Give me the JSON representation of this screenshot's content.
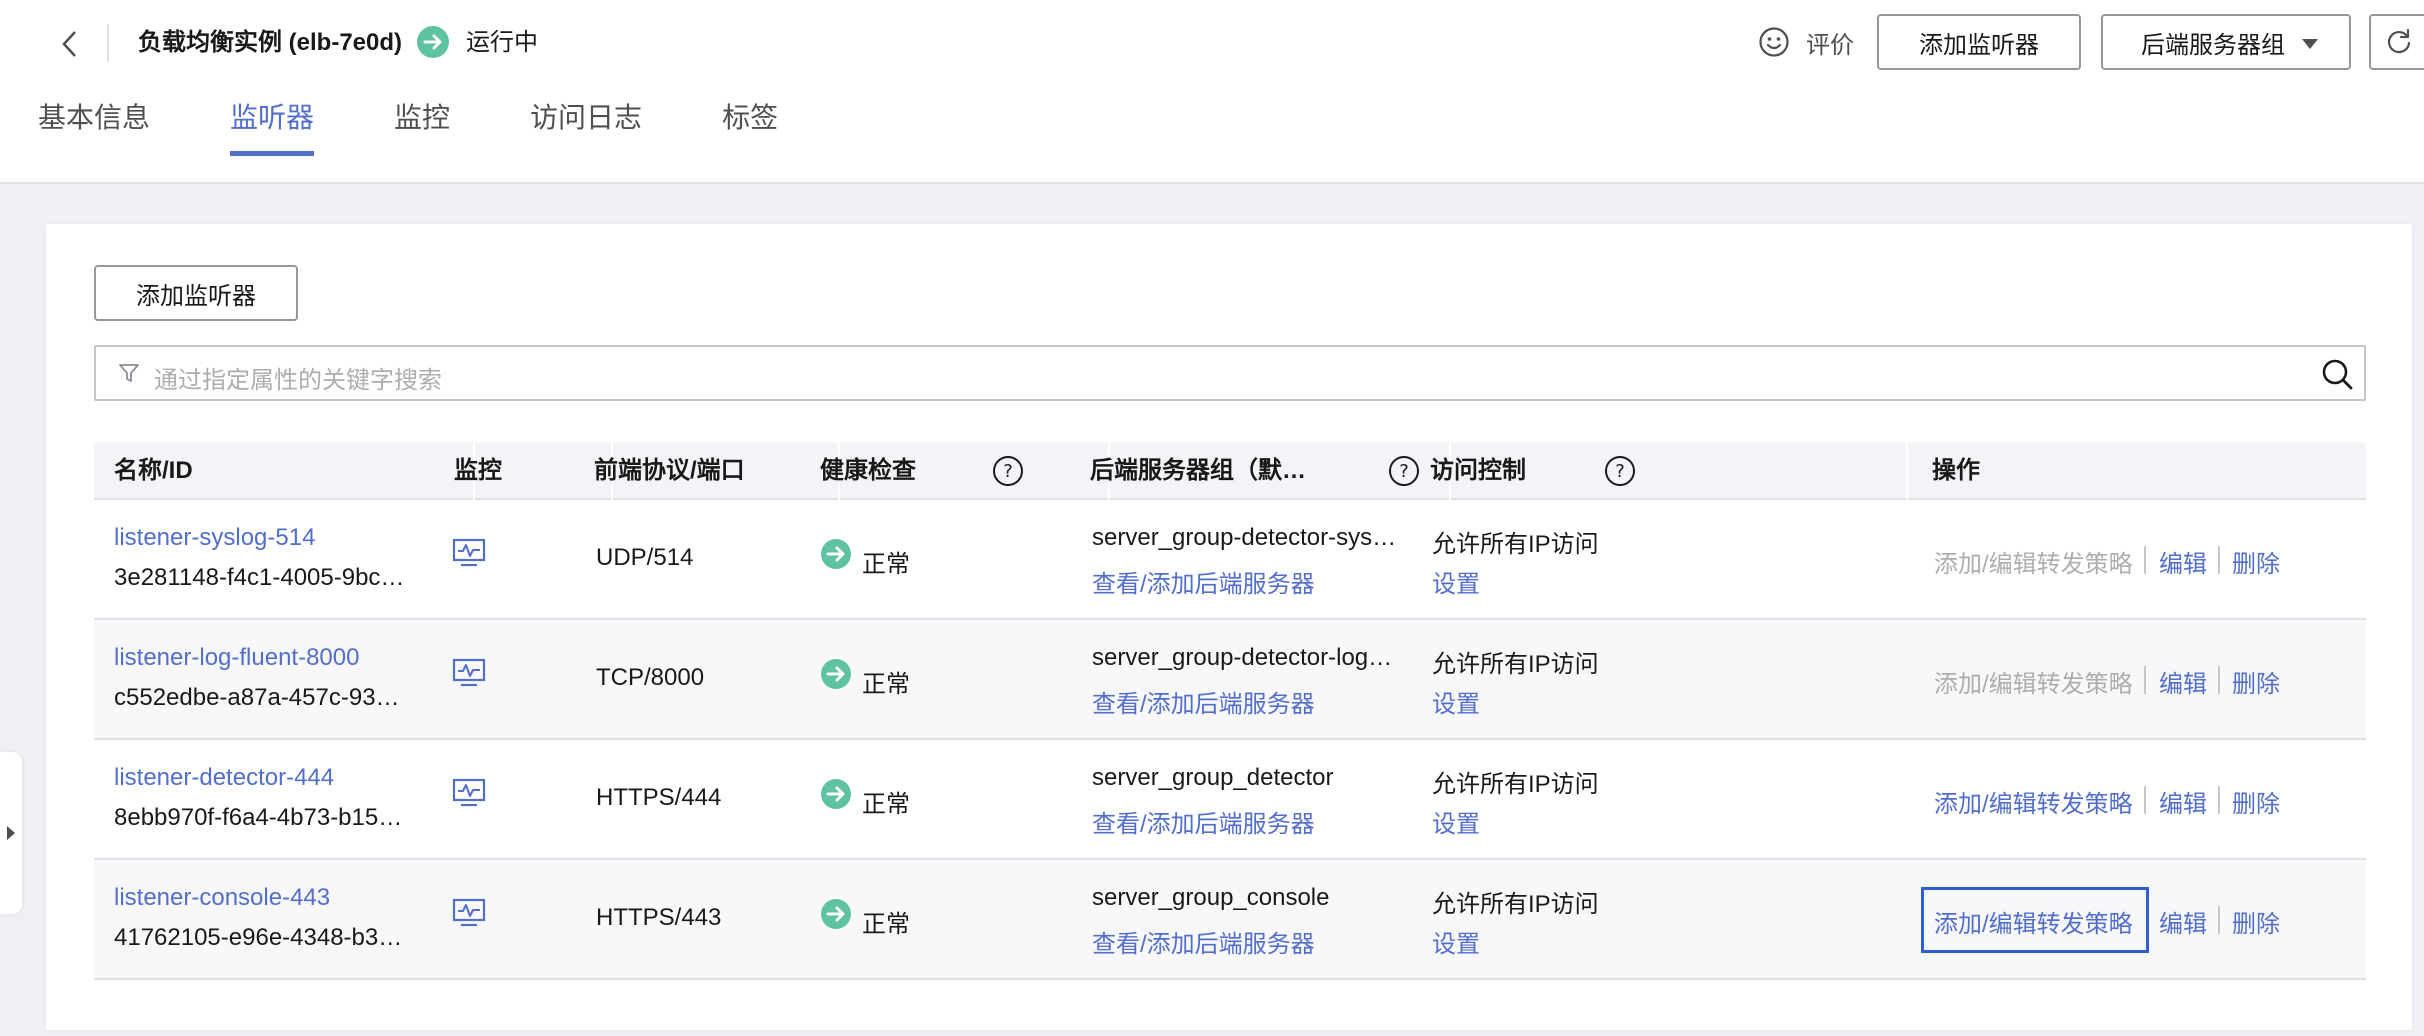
{
  "header": {
    "title": "负载均衡实例 (elb-7e0d)",
    "status": "运行中",
    "feedback_label": "评价",
    "add_listener_button": "添加监听器",
    "server_group_button": "后端服务器组",
    "status_color": "#5ec29e",
    "accent_color": "#526ecc"
  },
  "tabs": [
    {
      "label": "基本信息",
      "active": false
    },
    {
      "label": "监听器",
      "active": true
    },
    {
      "label": "监控",
      "active": false
    },
    {
      "label": "访问日志",
      "active": false
    },
    {
      "label": "标签",
      "active": false
    }
  ],
  "toolbar": {
    "add_listener_button": "添加监听器",
    "search_placeholder": "通过指定属性的关键字搜索"
  },
  "table": {
    "columns": [
      "名称/ID",
      "监控",
      "前端协议/端口",
      "健康检查",
      "后端服务器组（默…",
      "访问控制",
      "操作"
    ],
    "rows": [
      {
        "name": "listener-syslog-514",
        "id": "3e281148-f4c1-4005-9bc…",
        "protocol": "UDP/514",
        "health": "正常",
        "server_group": "server_group-detector-sys…",
        "server_group_link": "查看/添加后端服务器",
        "access": "允许所有IP访问",
        "access_link": "设置",
        "op_policy": "添加/编辑转发策略",
        "op_policy_enabled": false,
        "op_edit": "编辑",
        "op_delete": "删除"
      },
      {
        "name": "listener-log-fluent-8000",
        "id": "c552edbe-a87a-457c-93…",
        "protocol": "TCP/8000",
        "health": "正常",
        "server_group": "server_group-detector-log…",
        "server_group_link": "查看/添加后端服务器",
        "access": "允许所有IP访问",
        "access_link": "设置",
        "op_policy": "添加/编辑转发策略",
        "op_policy_enabled": false,
        "op_edit": "编辑",
        "op_delete": "删除"
      },
      {
        "name": "listener-detector-444",
        "id": "8ebb970f-f6a4-4b73-b15…",
        "protocol": "HTTPS/444",
        "health": "正常",
        "server_group": "server_group_detector",
        "server_group_link": "查看/添加后端服务器",
        "access": "允许所有IP访问",
        "access_link": "设置",
        "op_policy": "添加/编辑转发策略",
        "op_policy_enabled": true,
        "op_edit": "编辑",
        "op_delete": "删除"
      },
      {
        "name": "listener-console-443",
        "id": "41762105-e96e-4348-b3…",
        "protocol": "HTTPS/443",
        "health": "正常",
        "server_group": "server_group_console",
        "server_group_link": "查看/添加后端服务器",
        "access": "允许所有IP访问",
        "access_link": "设置",
        "op_policy": "添加/编辑转发策略",
        "op_policy_enabled": true,
        "op_edit": "编辑",
        "op_delete": "删除"
      }
    ]
  }
}
